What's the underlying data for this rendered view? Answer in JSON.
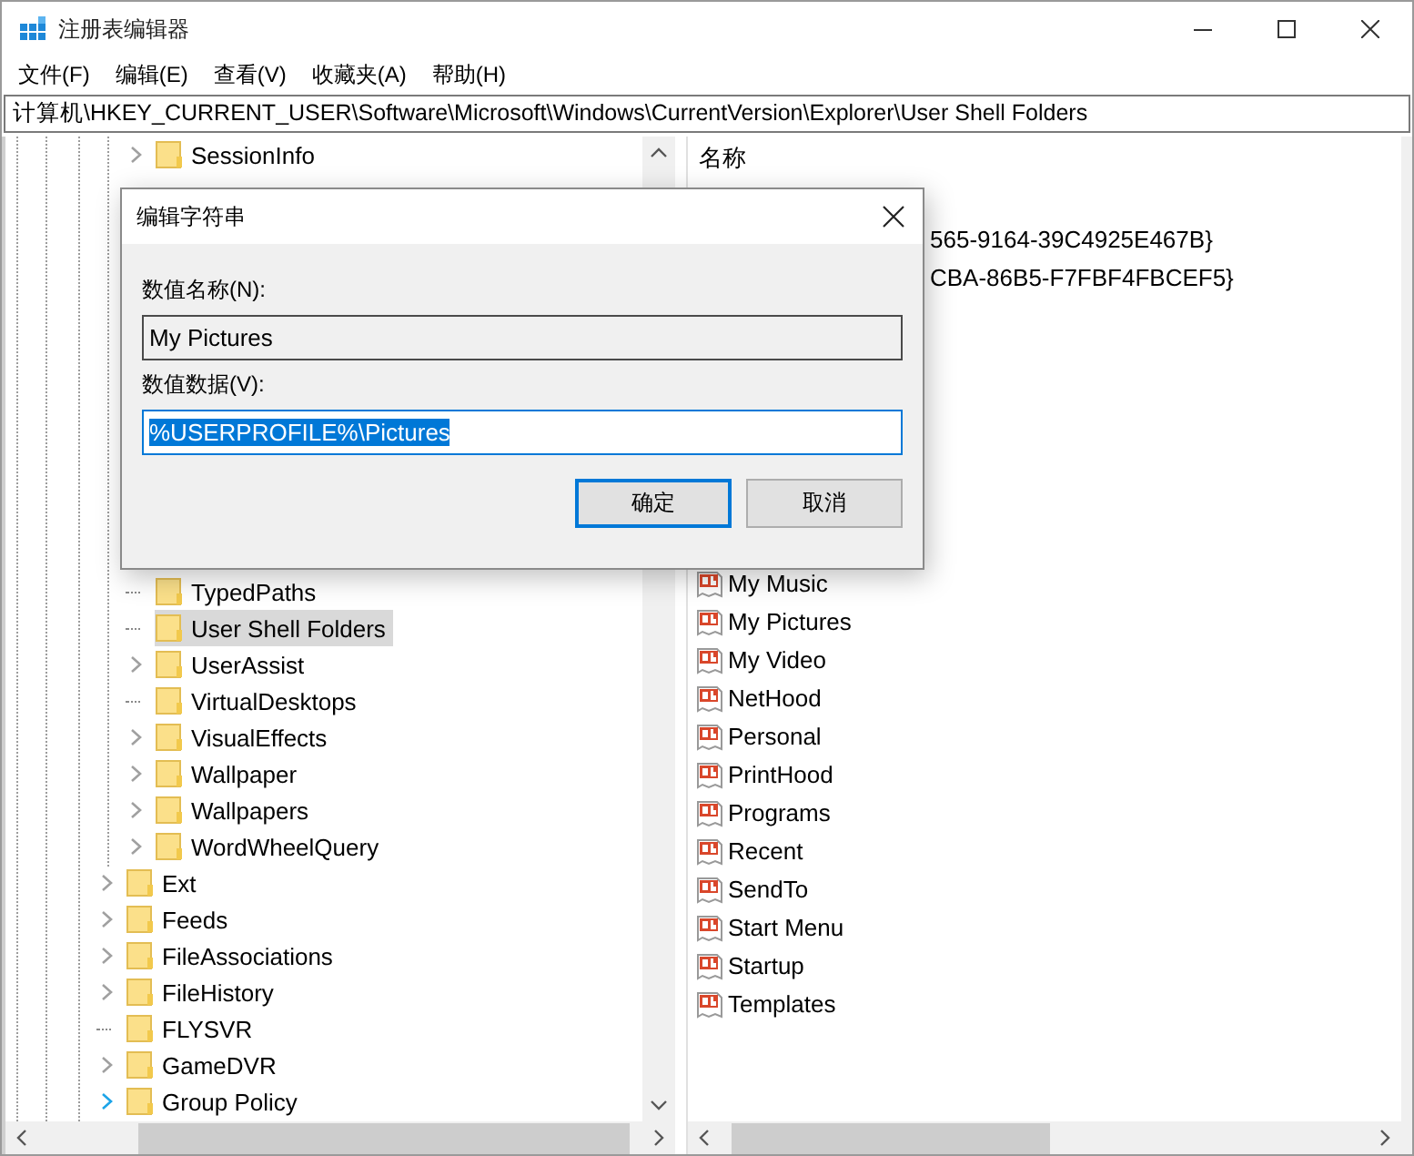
{
  "window": {
    "title": "注册表编辑器"
  },
  "menu": [
    "文件(F)",
    "编辑(E)",
    "查看(V)",
    "收藏夹(A)",
    "帮助(H)"
  ],
  "address": "计算机\\HKEY_CURRENT_USER\\Software\\Microsoft\\Windows\\CurrentVersion\\Explorer\\User Shell Folders",
  "tree": {
    "items": [
      {
        "children": [
          {
            "label": "SessionInfo",
            "expandable": true,
            "selected": false,
            "hovered": false
          },
          {
            "label": "TypedPaths",
            "expandable": false,
            "selected": false,
            "hovered": false
          },
          {
            "label": "User Shell Folders",
            "expandable": false,
            "selected": true,
            "hovered": false
          },
          {
            "label": "UserAssist",
            "expandable": true,
            "selected": false,
            "hovered": false
          },
          {
            "label": "VirtualDesktops",
            "expandable": false,
            "selected": false,
            "hovered": false
          },
          {
            "label": "VisualEffects",
            "expandable": true,
            "selected": false,
            "hovered": false
          },
          {
            "label": "Wallpaper",
            "expandable": true,
            "selected": false,
            "hovered": false
          },
          {
            "label": "Wallpapers",
            "expandable": true,
            "selected": false,
            "hovered": false
          },
          {
            "label": "WordWheelQuery",
            "expandable": true,
            "selected": false,
            "hovered": false
          }
        ]
      },
      {
        "label": "Ext",
        "expandable": true,
        "selected": false,
        "hovered": false
      },
      {
        "label": "Feeds",
        "expandable": true,
        "selected": false,
        "hovered": false
      },
      {
        "label": "FileAssociations",
        "expandable": true,
        "selected": false,
        "hovered": false
      },
      {
        "label": "FileHistory",
        "expandable": true,
        "selected": false,
        "hovered": false
      },
      {
        "label": "FLYSVR",
        "expandable": false,
        "selected": false,
        "hovered": false
      },
      {
        "label": "GameDVR",
        "expandable": true,
        "selected": false,
        "hovered": false
      },
      {
        "label": "Group Policy",
        "expandable": true,
        "selected": false,
        "hovered": true
      }
    ]
  },
  "values": {
    "header": "名称",
    "rows": [
      {
        "name": "565-9164-39C4925E467B}",
        "kind": "partial"
      },
      {
        "name": "CBA-86B5-F7FBF4FBCEF5}",
        "kind": "partial"
      },
      {
        "name": "My Music",
        "kind": "string"
      },
      {
        "name": "My Pictures",
        "kind": "string"
      },
      {
        "name": "My Video",
        "kind": "string"
      },
      {
        "name": "NetHood",
        "kind": "string"
      },
      {
        "name": "Personal",
        "kind": "string"
      },
      {
        "name": "PrintHood",
        "kind": "string"
      },
      {
        "name": "Programs",
        "kind": "string"
      },
      {
        "name": "Recent",
        "kind": "string"
      },
      {
        "name": "SendTo",
        "kind": "string"
      },
      {
        "name": "Start Menu",
        "kind": "string"
      },
      {
        "name": "Startup",
        "kind": "string"
      },
      {
        "name": "Templates",
        "kind": "string"
      }
    ]
  },
  "dialog": {
    "title": "编辑字符串",
    "name_label": "数值名称(N):",
    "name_field": {
      "value": "My Pictures",
      "readonly": true
    },
    "data_label": "数值数据(V):",
    "data_field": {
      "value": "%USERPROFILE%\\Pictures",
      "selected": true
    },
    "buttons": [
      {
        "label": "确定",
        "default": true
      },
      {
        "label": "取消",
        "default": false
      }
    ]
  }
}
